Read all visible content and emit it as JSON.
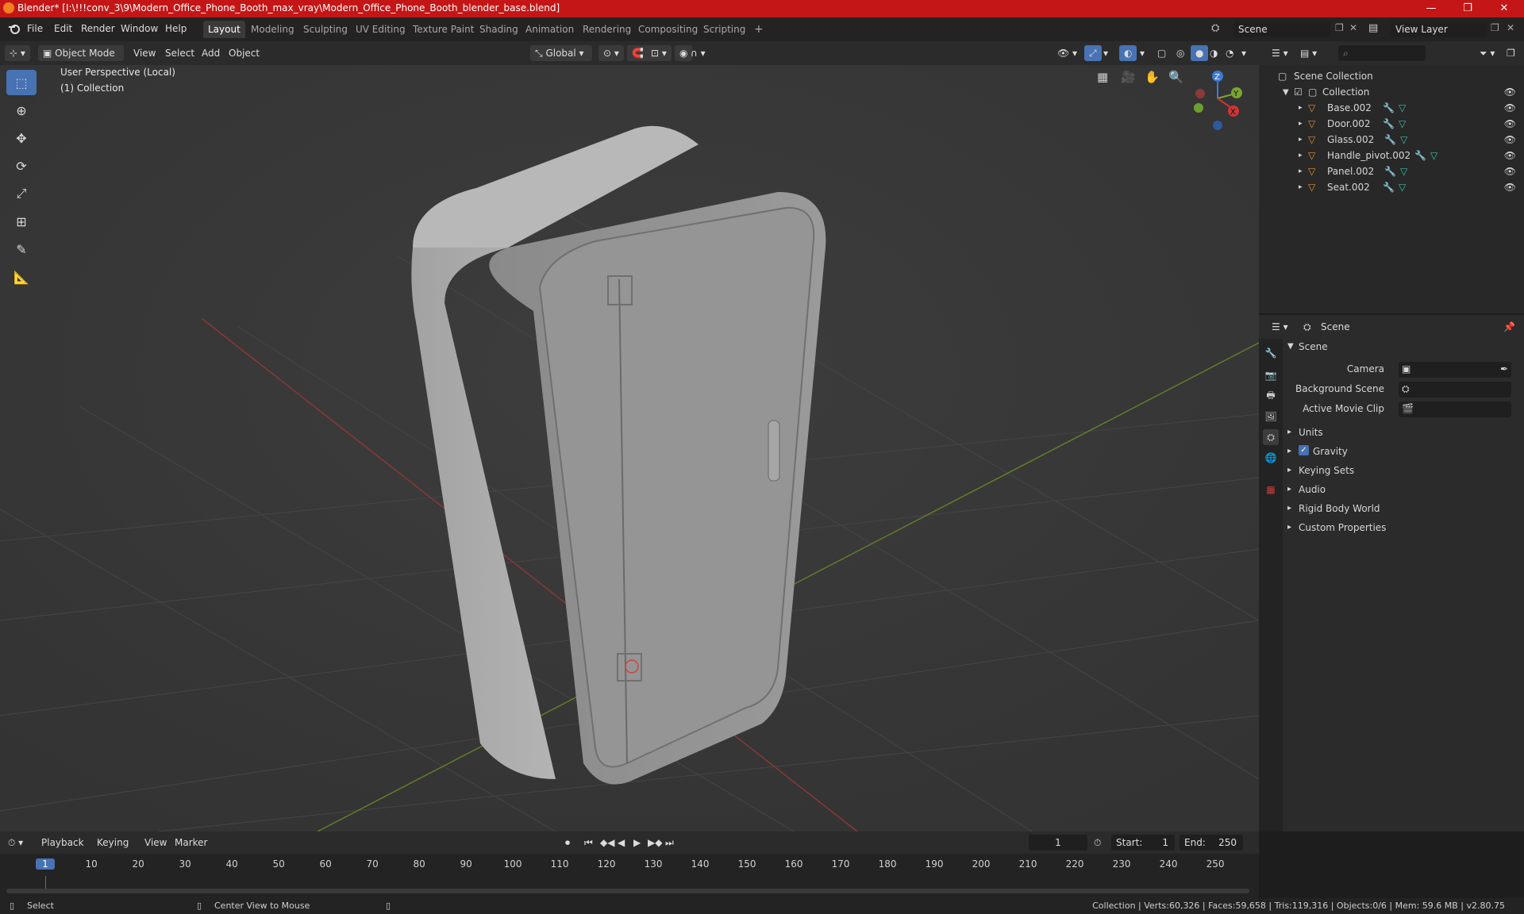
{
  "titlebar": {
    "title": "Blender* [I:\\!!!conv_3\\9\\Modern_Office_Phone_Booth_max_vray\\Modern_Office_Phone_Booth_blender_base.blend]",
    "minimize": "—",
    "maximize": "❐",
    "close": "✕"
  },
  "menu": [
    "File",
    "Edit",
    "Render",
    "Window",
    "Help"
  ],
  "workspaces": [
    "Layout",
    "Modeling",
    "Sculpting",
    "UV Editing",
    "Texture Paint",
    "Shading",
    "Animation",
    "Rendering",
    "Compositing",
    "Scripting"
  ],
  "add_workspace": "+",
  "scene_field": "Scene",
  "view_layer_field": "View Layer",
  "viewport_header": {
    "mode": "Object Mode",
    "menus": [
      "View",
      "Select",
      "Add",
      "Object"
    ],
    "transform": "Global"
  },
  "viewport": {
    "perspective_label": "User Perspective (Local)",
    "collection_label": "(1) Collection",
    "gizmo": {
      "x": "X",
      "y": "Y",
      "z": "Z"
    }
  },
  "outliner": {
    "root": "Scene Collection",
    "collection": "Collection",
    "objects": [
      "Base.002",
      "Door.002",
      "Glass.002",
      "Handle_pivot.002",
      "Panel.002",
      "Seat.002"
    ]
  },
  "properties": {
    "header": "Scene",
    "panel_title": "Scene",
    "camera_label": "Camera",
    "background_label": "Background Scene",
    "movie_clip_label": "Active Movie Clip",
    "sections": [
      "Units",
      "Gravity",
      "Keying Sets",
      "Audio",
      "Rigid Body World",
      "Custom Properties"
    ]
  },
  "timeline": {
    "menus": [
      "Playback",
      "Keying",
      "View",
      "Marker"
    ],
    "current_frame": "1",
    "start_label": "Start:",
    "start": "1",
    "end_label": "End:",
    "end": "250",
    "ticks": [
      "1",
      "10",
      "20",
      "30",
      "40",
      "50",
      "60",
      "70",
      "80",
      "90",
      "100",
      "110",
      "120",
      "130",
      "140",
      "150",
      "160",
      "170",
      "180",
      "190",
      "200",
      "210",
      "220",
      "230",
      "240",
      "250"
    ]
  },
  "status": {
    "select": "Select",
    "center": "Center View to Mouse",
    "stats": "Collection | Verts:60,326 | Faces:59,658 | Tris:119,316 | Objects:0/6 | Mem: 59.6 MB | v2.80.75"
  },
  "colors": {
    "titlebar": "#c41616",
    "accent": "#4772b3",
    "x_axis": "#b83030",
    "y_axis": "#6a9a2a"
  }
}
